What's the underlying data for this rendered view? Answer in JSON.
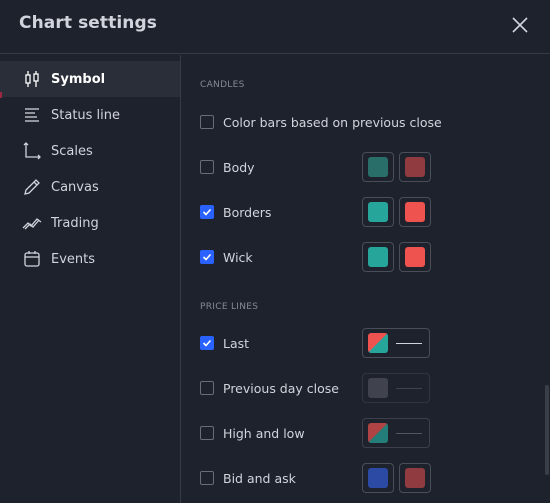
{
  "dialog": {
    "title": "Chart settings"
  },
  "sidebar": {
    "items": [
      {
        "label": "Symbol",
        "icon": "candlestick-icon",
        "active": true
      },
      {
        "label": "Status line",
        "icon": "status-line-icon",
        "active": false
      },
      {
        "label": "Scales",
        "icon": "scales-icon",
        "active": false
      },
      {
        "label": "Canvas",
        "icon": "pencil-icon",
        "active": false
      },
      {
        "label": "Trading",
        "icon": "trading-icon",
        "active": false
      },
      {
        "label": "Events",
        "icon": "calendar-icon",
        "active": false
      }
    ]
  },
  "candles": {
    "section_label": "CANDLES",
    "color_bars": {
      "label": "Color bars based on previous close",
      "checked": false
    },
    "body": {
      "label": "Body",
      "checked": false,
      "up_color": "#2a6e6a",
      "down_color": "#8f3b3f"
    },
    "borders": {
      "label": "Borders",
      "checked": true,
      "up_color": "#26a69a",
      "down_color": "#ef5350"
    },
    "wick": {
      "label": "Wick",
      "checked": true,
      "up_color": "#26a69a",
      "down_color": "#ef5350"
    }
  },
  "price_lines": {
    "section_label": "PRICE LINES",
    "last": {
      "label": "Last",
      "checked": true
    },
    "prev_close": {
      "label": "Previous day close",
      "checked": false
    },
    "high_low": {
      "label": "High and low",
      "checked": false
    },
    "bid_ask": {
      "label": "Bid and ask",
      "checked": false,
      "bid_color": "#2c4aa3",
      "ask_color": "#8f3b3f"
    }
  },
  "colors": {
    "background": "#1e222d",
    "accent": "#2962ff",
    "active_bg": "#2a2e39"
  }
}
